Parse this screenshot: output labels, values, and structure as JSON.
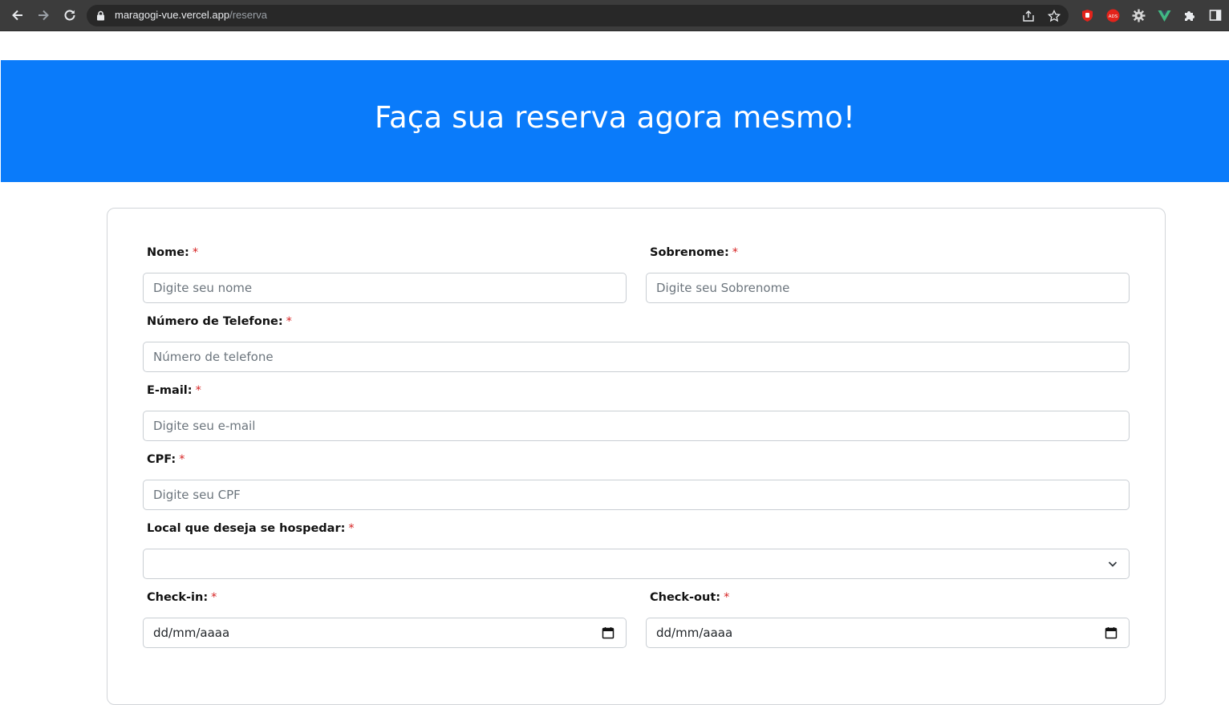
{
  "browser": {
    "url_host": "maragogi-vue.vercel.app",
    "url_path": "/reserva"
  },
  "banner": {
    "title": "Faça sua reserva agora mesmo!",
    "background": "#0a7bfa"
  },
  "form": {
    "required_mark": "*",
    "nome": {
      "label": "Nome:",
      "placeholder": "Digite seu nome"
    },
    "sobrenome": {
      "label": "Sobrenome:",
      "placeholder": "Digite seu Sobrenome"
    },
    "telefone": {
      "label": "Número de Telefone:",
      "placeholder": "Número de telefone"
    },
    "email": {
      "label": "E-mail:",
      "placeholder": "Digite seu e-mail"
    },
    "cpf": {
      "label": "CPF:",
      "placeholder": "Digite seu CPF"
    },
    "local": {
      "label": "Local que deseja se hospedar:",
      "value": ""
    },
    "checkin": {
      "label": "Check-in:",
      "value": "dd/mm/aaaa"
    },
    "checkout": {
      "label": "Check-out:",
      "value": "dd/mm/aaaa"
    }
  },
  "icons": {
    "back": "arrow-left-icon",
    "forward": "arrow-right-icon",
    "reload": "reload-icon",
    "lock": "lock-icon",
    "share": "share-icon",
    "bookmark": "star-icon",
    "extensions": [
      "ublock-icon",
      "adblock-icon",
      "gear-icon",
      "vue-devtools-icon",
      "puzzle-icon",
      "side-panel-icon"
    ],
    "calendar": "calendar-icon",
    "dropdown": "chevron-down-icon"
  },
  "colors": {
    "accent": "#0a7bfa",
    "required": "#d62222"
  }
}
